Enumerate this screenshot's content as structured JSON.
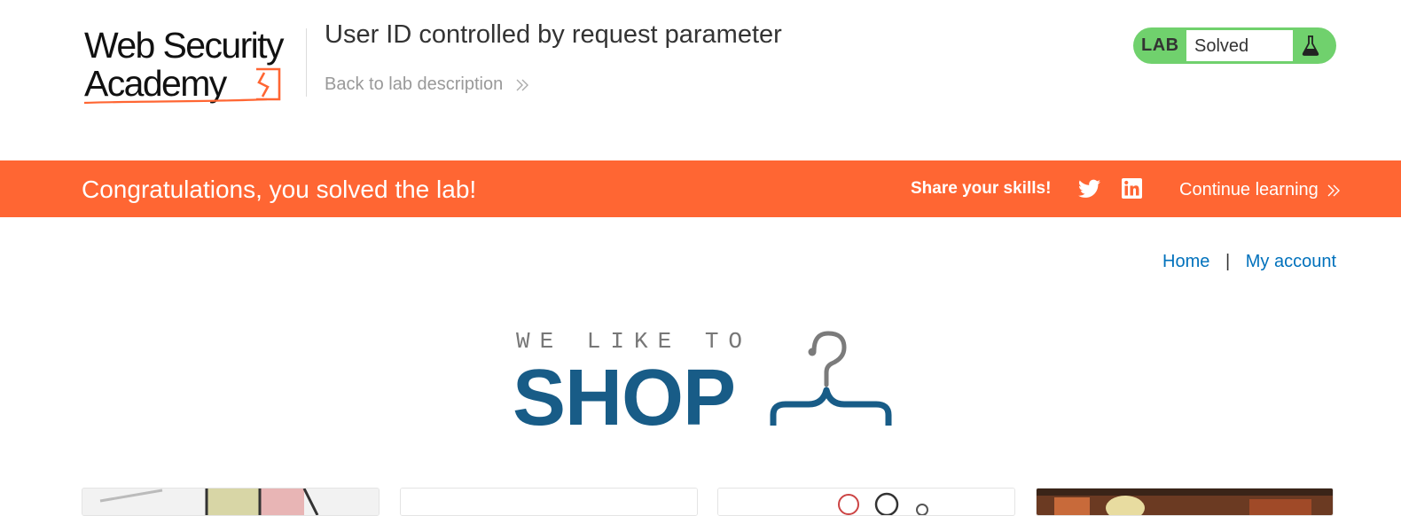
{
  "academy_header": {
    "logo_line1": "Web Security",
    "logo_line2": "Academy",
    "lab_title": "User ID controlled by request parameter",
    "back_link": "Back to lab description",
    "status": {
      "tag": "LAB",
      "text": "Solved",
      "color": "#70d16d"
    }
  },
  "banner": {
    "message": "Congratulations, you solved the lab!",
    "share_label": "Share your skills!",
    "share_icons": [
      "twitter-icon",
      "linkedin-icon"
    ],
    "continue_label": "Continue learning",
    "color": "#ff6633"
  },
  "nav": {
    "home": "Home",
    "separator": "|",
    "account": "My account",
    "link_color": "#0071bc"
  },
  "shop_logo": {
    "tagline": "WE LIKE TO",
    "word": "SHOP",
    "icon": "hanger-icon",
    "color": "#185c87"
  },
  "products": [
    {
      "thumb": "product-image-1"
    },
    {
      "thumb": "product-image-2"
    },
    {
      "thumb": "product-image-3"
    },
    {
      "thumb": "product-image-4"
    }
  ]
}
